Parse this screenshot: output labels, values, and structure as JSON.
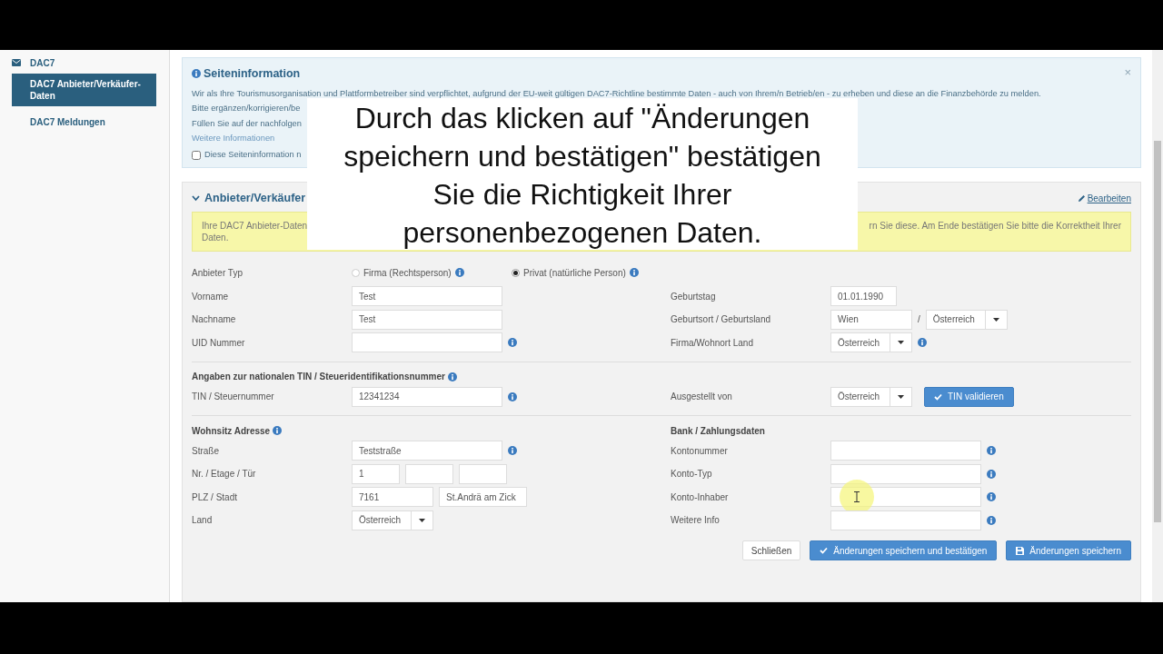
{
  "sidebar": {
    "section": "DAC7",
    "items": [
      {
        "label": "DAC7 Anbieter/Verkäufer-Daten",
        "selected": true
      },
      {
        "label": "DAC7 Meldungen",
        "selected": false
      }
    ]
  },
  "info_panel": {
    "title": "Seiteninformation",
    "close": "×",
    "lines": [
      "Wir als Ihre Tourismusorganisation und Plattformbetreiber sind verpflichtet, aufgrund der EU-weit gültigen DAC7-Richtline bestimmte Daten - auch von Ihrem/n Betrieb/en - zu erheben und diese an die Finanzbehörde zu melden.",
      "Bitte ergänzen/korrigieren/be",
      "Füllen Sie auf der nachfolgen"
    ],
    "link": "Weitere Informationen",
    "checkbox": {
      "label": "Diese Seiteninformation n",
      "checked": false
    }
  },
  "section": {
    "title": "Anbieter/Verkäufer",
    "expanded": true,
    "edit_link": "Bearbeiten",
    "alert": {
      "left": "Ihre DAC7 Anbieter-Daten",
      "right": "rn Sie diese. Am Ende bestätigen Sie bitte die Korrektheit Ihrer",
      "line_2": "Daten."
    },
    "type_row": {
      "label": "Anbieter Typ",
      "options": [
        {
          "label": "Firma (Rechtsperson)",
          "selected": false
        },
        {
          "label": "Privat (natürliche Person)",
          "selected": true
        }
      ]
    },
    "blocks": [
      {
        "left": {
          "fields": [
            {
              "label": "Vorname",
              "controls": [
                {
                  "kind": "input",
                  "value": "Test"
                }
              ]
            },
            {
              "label": "Nachname",
              "controls": [
                {
                  "kind": "input",
                  "value": "Test"
                }
              ]
            },
            {
              "label": "UID Nummer",
              "controls": [
                {
                  "kind": "input"
                }
              ],
              "info": true
            }
          ]
        },
        "right": {
          "fields": [
            {
              "label": "Geburtstag",
              "controls": [
                {
                  "kind": "date",
                  "value": "01.01.1990"
                }
              ]
            },
            {
              "label": "Geburtsort / Geburtsland",
              "controls": [
                {
                  "kind": "input",
                  "value": "Wien"
                },
                {
                  "kind": "separator",
                  "text": "/"
                },
                {
                  "kind": "select",
                  "value": "Österreich"
                }
              ]
            },
            {
              "label": "Firma/Wohnort Land",
              "controls": [
                {
                  "kind": "select",
                  "value": "Österreich"
                }
              ],
              "info": true
            }
          ]
        }
      },
      {
        "left": {
          "heading": "Angaben zur nationalen TIN / Steueridentifikationsnummer",
          "heading_info": true,
          "fields": [
            {
              "label": "TIN / Steuernummer",
              "controls": [
                {
                  "kind": "input",
                  "value": "12341234"
                }
              ],
              "info": true
            }
          ]
        },
        "right": {
          "fields": [
            {
              "label": "Ausgestellt von",
              "controls": [
                {
                  "kind": "select",
                  "value": "Österreich"
                },
                {
                  "kind": "button",
                  "label": "TIN validieren"
                }
              ]
            }
          ]
        }
      },
      {
        "left": {
          "heading": "Wohnsitz Adresse",
          "heading_info": true,
          "fields": [
            {
              "label": "Straße",
              "controls": [
                {
                  "kind": "input",
                  "value": "Teststraße"
                }
              ],
              "info": true
            },
            {
              "label": "Nr. / Etage / Tür",
              "controls": [
                {
                  "kind": "input",
                  "value": "1"
                },
                {
                  "kind": "input"
                },
                {
                  "kind": "input"
                }
              ]
            },
            {
              "label": "PLZ / Stadt",
              "controls": [
                {
                  "kind": "input",
                  "value": "7161"
                },
                {
                  "kind": "input",
                  "value": "St.Andrä am Zick"
                }
              ]
            },
            {
              "label": "Land",
              "controls": [
                {
                  "kind": "select",
                  "value": "Österreich"
                }
              ]
            }
          ]
        },
        "right": {
          "heading": "Bank / Zahlungsdaten",
          "heading_info": false,
          "fields": [
            {
              "label": "Kontonummer",
              "controls": [
                {
                  "kind": "input"
                }
              ],
              "info": true
            },
            {
              "label": "Konto-Typ",
              "controls": [
                {
                  "kind": "input"
                }
              ],
              "info": true
            },
            {
              "label": "Konto-Inhaber",
              "controls": [
                {
                  "kind": "input"
                }
              ],
              "info": true,
              "hover": true
            },
            {
              "label": "Weitere Info",
              "controls": [
                {
                  "kind": "input"
                }
              ],
              "info": true
            }
          ]
        }
      }
    ],
    "buttons": [
      {
        "kind": "close",
        "label": "Schließen"
      },
      {
        "kind": "confirm",
        "label": "Änderungen speichern und bestätigen"
      },
      {
        "kind": "save",
        "label": "Änderungen speichern"
      }
    ]
  },
  "subtitle": {
    "lines": [
      "Durch das klicken auf \"Änderungen",
      "speichern und bestätigen\" bestätigen",
      "Sie die Richtigkeit Ihrer",
      "personenbezogenen Daten."
    ]
  }
}
